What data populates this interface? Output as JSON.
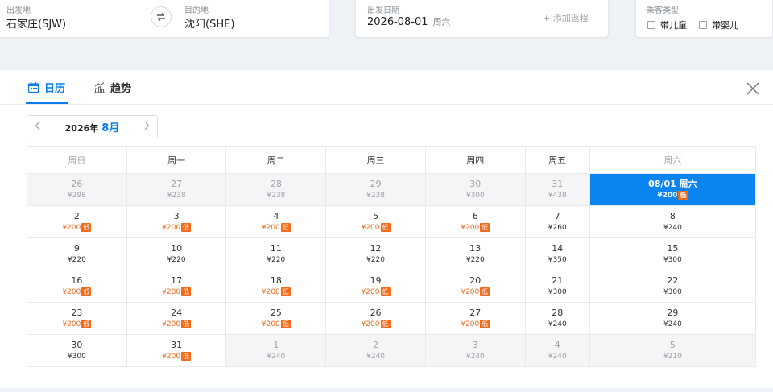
{
  "search": {
    "origin_label": "出发地",
    "origin_value": "石家庄(SJW)",
    "destination_label": "目的地",
    "destination_value": "沈阳(SHE)",
    "depart_label": "出发日期",
    "depart_value": "2026-08-01",
    "depart_weekday": "周六",
    "add_return": "+ 添加返程",
    "pax_label": "乘客类型",
    "pax_child": "带儿童",
    "pax_infant": "带婴儿"
  },
  "tabs": {
    "calendar": "日历",
    "trend": "趋势"
  },
  "calendar": {
    "year": "2026年",
    "month": "8月",
    "weekdays": [
      "周日",
      "周一",
      "周二",
      "周三",
      "周四",
      "周五",
      "周六"
    ],
    "low_badge": "低",
    "weeks": [
      [
        {
          "day": "26",
          "price": "¥298",
          "out": true
        },
        {
          "day": "27",
          "price": "¥238",
          "out": true
        },
        {
          "day": "28",
          "price": "¥238",
          "out": true
        },
        {
          "day": "29",
          "price": "¥238",
          "out": true
        },
        {
          "day": "30",
          "price": "¥300",
          "out": true
        },
        {
          "day": "31",
          "price": "¥438",
          "out": true
        },
        {
          "day": "08/01 周六",
          "price": "¥200",
          "low": true,
          "selected": true
        }
      ],
      [
        {
          "day": "2",
          "price": "¥200",
          "low": true
        },
        {
          "day": "3",
          "price": "¥200",
          "low": true
        },
        {
          "day": "4",
          "price": "¥200",
          "low": true
        },
        {
          "day": "5",
          "price": "¥200",
          "low": true
        },
        {
          "day": "6",
          "price": "¥200",
          "low": true
        },
        {
          "day": "7",
          "price": "¥260"
        },
        {
          "day": "8",
          "price": "¥240"
        }
      ],
      [
        {
          "day": "9",
          "price": "¥220"
        },
        {
          "day": "10",
          "price": "¥220"
        },
        {
          "day": "11",
          "price": "¥220"
        },
        {
          "day": "12",
          "price": "¥220"
        },
        {
          "day": "13",
          "price": "¥220"
        },
        {
          "day": "14",
          "price": "¥350"
        },
        {
          "day": "15",
          "price": "¥300"
        }
      ],
      [
        {
          "day": "16",
          "price": "¥200",
          "low": true
        },
        {
          "day": "17",
          "price": "¥200",
          "low": true
        },
        {
          "day": "18",
          "price": "¥200",
          "low": true
        },
        {
          "day": "19",
          "price": "¥200",
          "low": true
        },
        {
          "day": "20",
          "price": "¥200",
          "low": true
        },
        {
          "day": "21",
          "price": "¥300"
        },
        {
          "day": "22",
          "price": "¥300"
        }
      ],
      [
        {
          "day": "23",
          "price": "¥200",
          "low": true
        },
        {
          "day": "24",
          "price": "¥200",
          "low": true
        },
        {
          "day": "25",
          "price": "¥200",
          "low": true
        },
        {
          "day": "26",
          "price": "¥200",
          "low": true
        },
        {
          "day": "27",
          "price": "¥200",
          "low": true
        },
        {
          "day": "28",
          "price": "¥240"
        },
        {
          "day": "29",
          "price": "¥240"
        }
      ],
      [
        {
          "day": "30",
          "price": "¥300"
        },
        {
          "day": "31",
          "price": "¥200",
          "low": true
        },
        {
          "day": "1",
          "price": "¥240",
          "out": true
        },
        {
          "day": "2",
          "price": "¥240",
          "out": true
        },
        {
          "day": "3",
          "price": "¥240",
          "out": true
        },
        {
          "day": "4",
          "price": "¥240",
          "out": true
        },
        {
          "day": "5",
          "price": "¥210",
          "out": true
        }
      ]
    ]
  },
  "colors": {
    "accent": "#0a7de6",
    "selected_bg": "#0a84f0",
    "low_price": "#f26b1d"
  }
}
